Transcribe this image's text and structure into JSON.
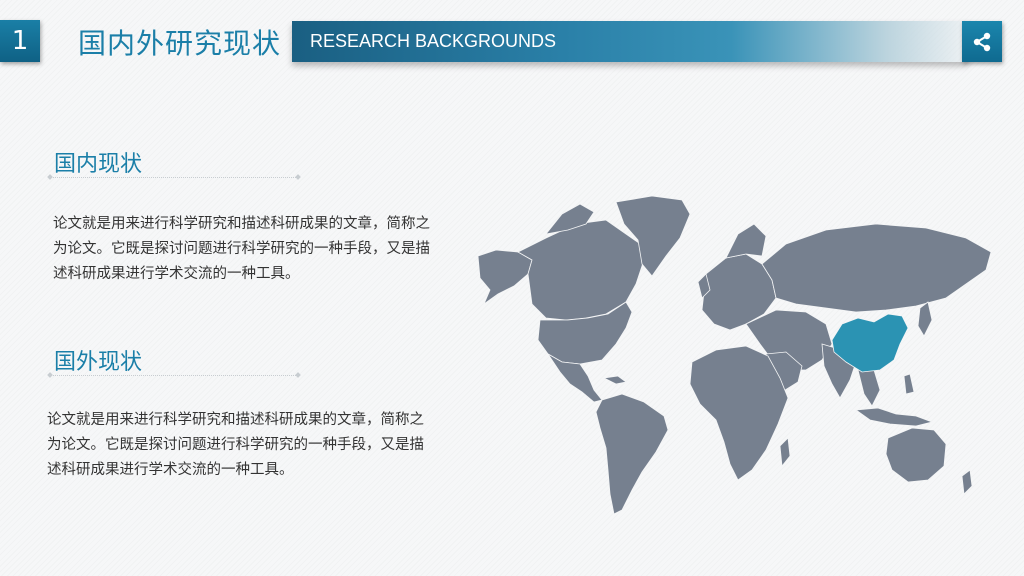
{
  "slide": {
    "number": "1",
    "title": "国内外研究现状",
    "banner_text": "RESEARCH BACKGROUNDS"
  },
  "domestic": {
    "title": "国内现状",
    "body": "论文就是用来进行科学研究和描述科研成果的文章，简称之为论文。它既是探讨问题进行科学研究的一种手段，又是描述科研成果进行学术交流的一种工具。"
  },
  "foreign": {
    "title": "国外现状",
    "body": "论文就是用来进行科学研究和描述科研成果的文章，简称之为论文。它既是探讨问题进行科学研究的一种手段，又是描述科研成果进行学术交流的一种工具。"
  },
  "icons": {
    "share": "share-icon"
  },
  "colors": {
    "accent": "#1b7fa8",
    "map_land": "#76808f",
    "map_highlight": "#2b93b3"
  }
}
